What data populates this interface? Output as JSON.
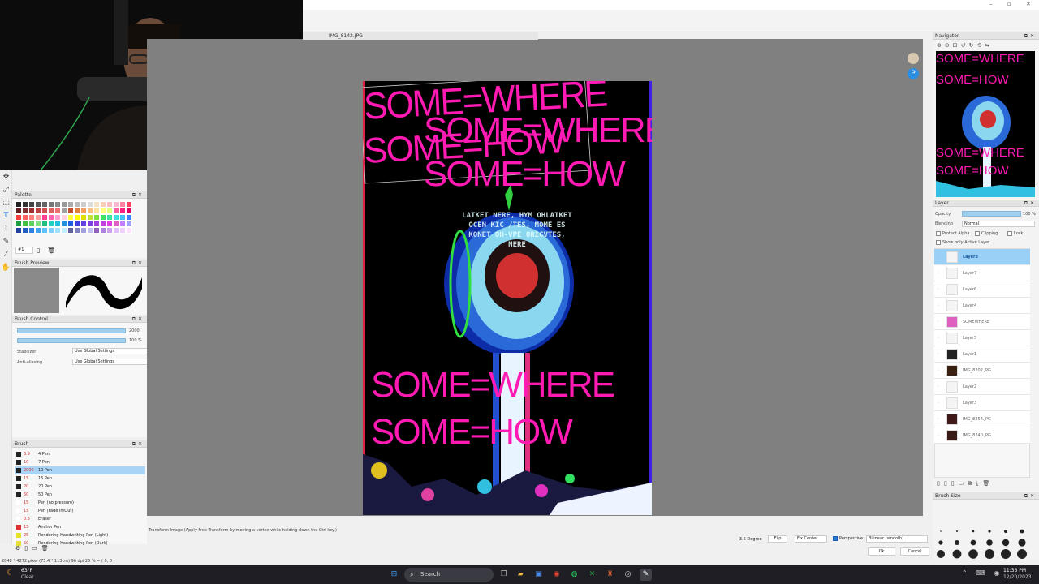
{
  "document": {
    "tab_title": "IMG_8142.JPG"
  },
  "panels": {
    "palette": "Palette",
    "brush_preview": "Brush Preview",
    "brush_control": "Brush Control",
    "brush": "Brush",
    "navigator": "Navigator",
    "layer": "Layer",
    "brush_size": "Brush Size"
  },
  "palette": {
    "index_label": "#1",
    "colors": [
      "#222222",
      "#333333",
      "#444444",
      "#555555",
      "#666666",
      "#777777",
      "#888888",
      "#999999",
      "#aaaaaa",
      "#bbbbbb",
      "#cccccc",
      "#dddddd",
      "#f6e3c8",
      "#f6d0b8",
      "#f6c0c0",
      "#f8b8d0",
      "#ff80a0",
      "#ff4060",
      "#602020",
      "#803030",
      "#a03030",
      "#c04040",
      "#d05050",
      "#e06060",
      "#f07070",
      "#a0a0a0",
      "#c05030",
      "#e08040",
      "#f0a060",
      "#f8c080",
      "#ffe0a0",
      "#ffff80",
      "#e0ff80",
      "#ff60a0",
      "#ff2080",
      "#e00060",
      "#f04040",
      "#ff6060",
      "#ff8080",
      "#ffa0a0",
      "#ff4090",
      "#ff60b0",
      "#ffa0d0",
      "#ffd0e0",
      "#ffff40",
      "#ffff00",
      "#e0e000",
      "#c0e040",
      "#80e040",
      "#40e060",
      "#40e0a0",
      "#40e0e0",
      "#40c0ff",
      "#4080ff",
      "#20a040",
      "#40c040",
      "#60d060",
      "#80e080",
      "#20c080",
      "#20d0c0",
      "#20c0e0",
      "#2090e0",
      "#2060e0",
      "#4040e0",
      "#6040e0",
      "#8040e0",
      "#a040e0",
      "#c040e0",
      "#e040e0",
      "#e060c0",
      "#c080ff",
      "#a0a0ff",
      "#2040a0",
      "#2060c0",
      "#3080e0",
      "#40a0f0",
      "#60c0ff",
      "#80d0ff",
      "#a0e0ff",
      "#c0f0ff",
      "#6060a0",
      "#8080c0",
      "#a0a0e0",
      "#c0c0f0",
      "#9060c0",
      "#b080e0",
      "#d0a0f0",
      "#e0c0ff",
      "#f0d0ff",
      "#ffe0ff"
    ]
  },
  "brush_control": {
    "size_value": "2000",
    "opacity_value": "100 %",
    "stabilizer_label": "Stabilizer",
    "stabilizer_value": "Use Global Settings",
    "antialias_label": "Anti-aliasing",
    "antialias_value": "Use Global Settings"
  },
  "brushes": [
    {
      "size": "3.9",
      "name": "4 Pen",
      "swatch": "#222222"
    },
    {
      "size": "10",
      "name": "7 Pen",
      "swatch": "#222222"
    },
    {
      "size": "2000",
      "name": "10 Pen",
      "swatch": "#222222",
      "selected": true
    },
    {
      "size": "15",
      "name": "15 Pen",
      "swatch": "#222222"
    },
    {
      "size": "20",
      "name": "20 Pen",
      "swatch": "#222222"
    },
    {
      "size": "50",
      "name": "50 Pen",
      "swatch": "#222222"
    },
    {
      "size": "15",
      "name": "Pen (no pressure)",
      "swatch": "#ffffff"
    },
    {
      "size": "15",
      "name": "Pen (Fade In/Out)",
      "swatch": "#ffffff"
    },
    {
      "size": "0.5",
      "name": "Eraser",
      "swatch": "#ffffff"
    },
    {
      "size": "15",
      "name": "Anchor Pen",
      "swatch": "#e03030"
    },
    {
      "size": "25",
      "name": "Rendering Handwriting Pen (Light)",
      "swatch": "#e8e030"
    },
    {
      "size": "50",
      "name": "Rendering Handwriting Pen (Dark)",
      "swatch": "#e8e030"
    }
  ],
  "artwork": {
    "line1": "SOME=WHERE",
    "line2": "SOME=HOW",
    "sphere_text": "LATKET NERE, HYM OHLATKET OCEN KIC /TES, MOME ES KONET OH-VPE ORICVTES, NERE"
  },
  "layer_panel": {
    "opacity_label": "Opacity",
    "opacity_value": "100 %",
    "blending_label": "Blending",
    "blending_value": "Normal",
    "protect_alpha": "Protect Alpha",
    "clipping": "Clipping",
    "lock": "Lock",
    "show_only_active": "Show only Active Layer",
    "layers": [
      {
        "name": "Layer8",
        "active": true,
        "thumb": "#f4f4f4"
      },
      {
        "name": "Layer7",
        "thumb": "#f4f4f4"
      },
      {
        "name": "Layer6",
        "thumb": "#f4f4f4"
      },
      {
        "name": "Layer4",
        "thumb": "#f4f4f4"
      },
      {
        "name": "SOMEWHERE",
        "thumb": "#e060c0"
      },
      {
        "name": "Layer5",
        "thumb": "#f4f4f4"
      },
      {
        "name": "Layer1",
        "thumb": "#222222"
      },
      {
        "name": "IMG_8202.JPG",
        "thumb": "#3a2010"
      },
      {
        "name": "Layer2",
        "thumb": "#f4f4f4"
      },
      {
        "name": "Layer3",
        "thumb": "#f4f4f4"
      },
      {
        "name": "IMG_8254.JPG",
        "thumb": "#401818"
      },
      {
        "name": "IMG_8240.JPG",
        "thumb": "#3a1a14"
      }
    ]
  },
  "status": {
    "hint": "Transform Image (Apply Free Transform by moving a vertex while holding down the Ctrl key.)",
    "dims": "2848 * 4272 pixel  (75.4 * 113cm)  96 dpi  25 %  = ( 0, 0 )",
    "angle": "-3.5 Degree",
    "flip": "Flip",
    "fix_center": "Fix Center",
    "perspective": "Perspective",
    "interp": "Bilinear (smooth)",
    "ok": "Ok",
    "cancel": "Cancel"
  },
  "taskbar": {
    "weather_temp": "63°F",
    "weather_desc": "Clear",
    "search_placeholder": "Search",
    "time": "11:36 PM",
    "date": "12/20/2023"
  }
}
